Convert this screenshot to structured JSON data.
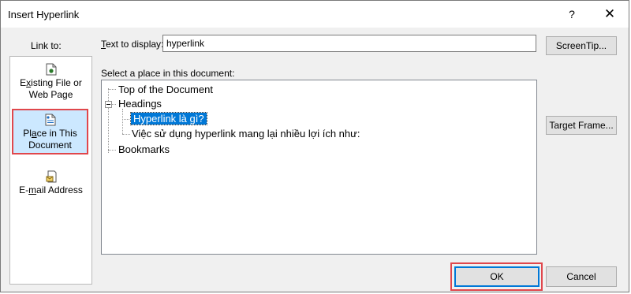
{
  "window": {
    "title": "Insert Hyperlink",
    "help_glyph": "?",
    "close_glyph": "✕"
  },
  "link_to": {
    "label": "Link to:",
    "items": [
      {
        "label_html": "E<u>x</u>isting File or<br>Web Page",
        "icon": "existing-file-icon"
      },
      {
        "label_html": "Pl<u>a</u>ce in This<br>Document",
        "icon": "document-page-icon",
        "selected": true
      },
      {
        "label_html": "E-<u>m</u>ail Address",
        "icon": "email-icon"
      }
    ]
  },
  "text_to_display": {
    "label": "Text to display:",
    "value": "hyperlink"
  },
  "buttons": {
    "screentip": "ScreenTip...",
    "target_frame": "Target Frame...",
    "ok": "OK",
    "cancel": "Cancel"
  },
  "place": {
    "label": "Select a place in this document:",
    "tree": {
      "top": "Top of the Document",
      "headings": "Headings",
      "heading_items": [
        "Hyperlink là gì?",
        "Việc sử dụng hyperlink mang lại nhiều lợi ích như:"
      ],
      "bookmarks": "Bookmarks"
    }
  },
  "colors": {
    "selection": "#0078d7",
    "highlight_border": "#e0474c",
    "selected_item_bg": "#cce8ff"
  }
}
